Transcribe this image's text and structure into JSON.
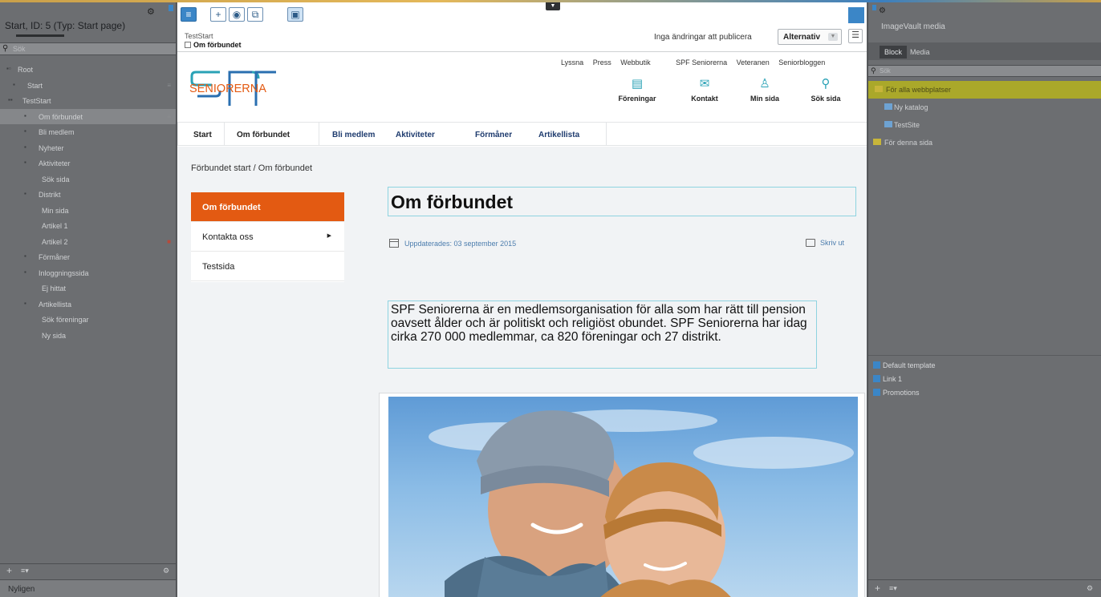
{
  "left_panel": {
    "title": "Start, ID: 5 (Typ: Start page)",
    "search_placeholder": "Sök",
    "tree": [
      {
        "label": "Root",
        "indent": 0,
        "selected": false
      },
      {
        "label": "Start",
        "indent": 1,
        "selected": false
      },
      {
        "label": "TestStart",
        "indent": 1,
        "selected": false
      },
      {
        "label": "Om förbundet",
        "indent": 2,
        "selected": true
      },
      {
        "label": "Bli medlem",
        "indent": 2,
        "selected": false
      },
      {
        "label": "Nyheter",
        "indent": 2,
        "selected": false
      },
      {
        "label": "Aktiviteter",
        "indent": 2,
        "selected": false
      },
      {
        "label": "Sök sida",
        "indent": 3,
        "selected": false
      },
      {
        "label": "Distrikt",
        "indent": 2,
        "selected": false
      },
      {
        "label": "Min sida",
        "indent": 3,
        "selected": false
      },
      {
        "label": "Artikel 1",
        "indent": 3,
        "selected": false
      },
      {
        "label": "Artikel 2",
        "indent": 3,
        "selected": false
      },
      {
        "label": "Förmåner",
        "indent": 2,
        "selected": false
      },
      {
        "label": "Inloggningssida",
        "indent": 2,
        "selected": false
      },
      {
        "label": "Ej hittat",
        "indent": 3,
        "selected": false
      },
      {
        "label": "Artikellista",
        "indent": 2,
        "selected": false
      },
      {
        "label": "Sök föreningar",
        "indent": 3,
        "selected": false
      },
      {
        "label": "Ny sida",
        "indent": 3,
        "selected": false
      }
    ],
    "footer_label": "Nyligen"
  },
  "toolbar": {
    "crumb_parent": "TestStart",
    "crumb_current": "Om förbundet",
    "publish_status": "Inga ändringar att publicera",
    "options_label": "Alternativ"
  },
  "site": {
    "logo_text": "SENIORERNA",
    "top_links": [
      "Lyssna",
      "Press",
      "Webbutik",
      "SPF Seniorerna",
      "Veteranen",
      "Seniorbloggen"
    ],
    "header_icons": [
      {
        "label": "Föreningar",
        "icon": "list-icon"
      },
      {
        "label": "Kontakt",
        "icon": "mail-icon"
      },
      {
        "label": "Min sida",
        "icon": "user-icon"
      },
      {
        "label": "Sök sida",
        "icon": "search-icon"
      }
    ],
    "nav": [
      "Start",
      "Om förbundet",
      "Bli medlem",
      "Aktiviteter",
      "Förmåner",
      "Artikellista"
    ],
    "breadcrumb_home": "Förbundet start",
    "breadcrumb_sep": "/",
    "breadcrumb_current": "Om förbundet",
    "subnav": [
      "Om förbundet",
      "Kontakta oss",
      "Testsida"
    ],
    "heading": "Om förbundet",
    "updated": "Uppdaterades: 03 september 2015",
    "print_label": "Skriv ut",
    "intro": "SPF Seniorerna är en medlemsorganisation för alla som har rätt till pension oavsett ålder och är politiskt och religiöst obundet. SPF Seniorerna har idag cirka 270 000 medlemmar, ca 820 föreningar och 27 distrikt."
  },
  "right_panel": {
    "title": "ImageVault media",
    "tabs": [
      "Block",
      "Media"
    ],
    "search_placeholder": "Sök",
    "folders": [
      {
        "label": "För alla webbplatser",
        "selected": true
      },
      {
        "label": "Ny katalog",
        "selected": false
      },
      {
        "label": "TestSite",
        "selected": false
      },
      {
        "label": "För denna sida",
        "selected": false
      }
    ],
    "blocks": [
      "Default template",
      "Link 1",
      "Promotions"
    ]
  },
  "colors": {
    "accent_orange": "#e35a12",
    "brand_blue": "#3b86c7",
    "teal": "#2aa2b6",
    "nav_blue": "#1e3b6e"
  }
}
